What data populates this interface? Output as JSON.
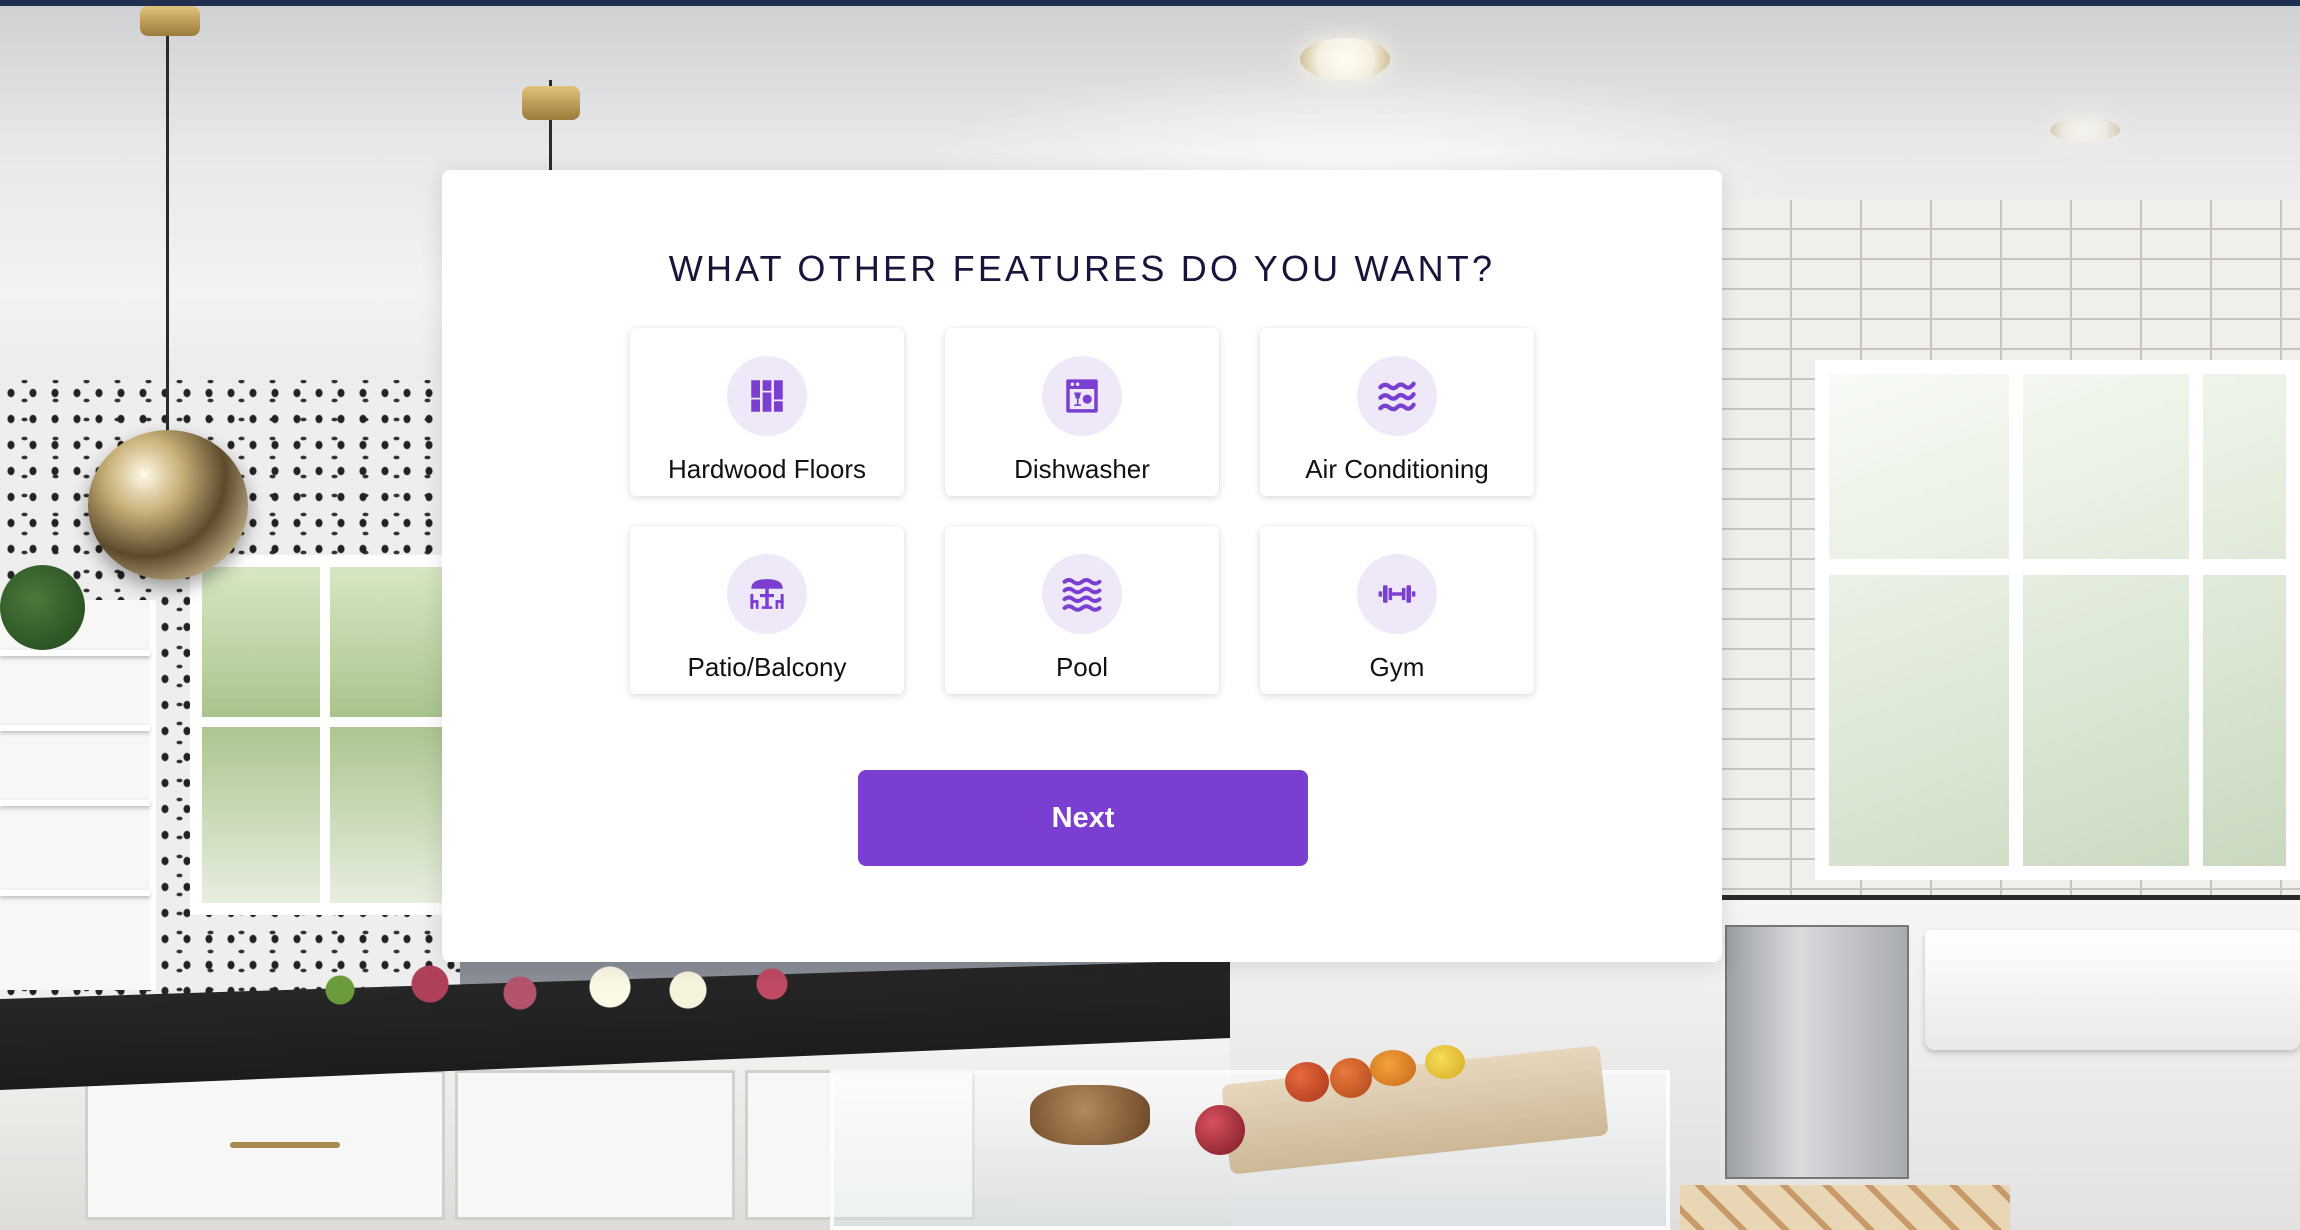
{
  "modal": {
    "title": "WHAT OTHER FEATURES DO YOU WANT?",
    "options": [
      {
        "label": "Hardwood Floors",
        "icon": "hardwood-floors-icon"
      },
      {
        "label": "Dishwasher",
        "icon": "dishwasher-icon"
      },
      {
        "label": "Air Conditioning",
        "icon": "air-conditioning-icon"
      },
      {
        "label": "Patio/Balcony",
        "icon": "patio-table-icon"
      },
      {
        "label": "Pool",
        "icon": "pool-waves-icon"
      },
      {
        "label": "Gym",
        "icon": "dumbbell-icon"
      }
    ],
    "next_label": "Next"
  },
  "colors": {
    "accent": "#7a3fd0",
    "icon_bg": "#efe8f9",
    "title_text": "#17153a",
    "top_bar": "#1f2f4f"
  },
  "background": {
    "scene": "kitchen-photo"
  }
}
